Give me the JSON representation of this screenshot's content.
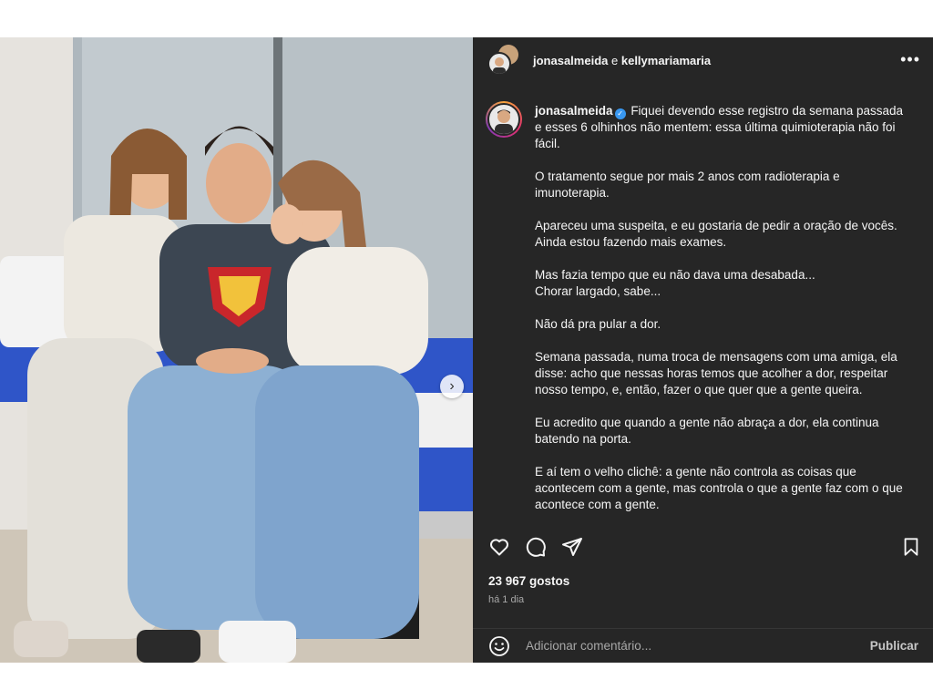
{
  "post": {
    "photo_alt": "Three people seated on a hospital bed hugging",
    "carousel_next_icon": "chevron-right-icon",
    "tag_icon": "user-icon"
  },
  "header": {
    "user1": "jonasalmeida",
    "conjunction": "e",
    "user2": "kellymariamaria",
    "more_icon": "more-horizontal-icon"
  },
  "caption": {
    "username": "jonasalmeida",
    "verified_icon": "verified-badge-icon",
    "paragraphs": [
      "Fiquei devendo esse registro da semana passada e esses 6 olhinhos não mentem: essa última quimioterapia não foi fácil.",
      "O tratamento segue por mais 2 anos com radioterapia e imunoterapia.",
      "Apareceu uma suspeita, e eu gostaria de pedir a oração de vocês. Ainda estou fazendo mais exames.",
      "Mas fazia tempo que eu não dava uma desabada...\nChorar largado, sabe...",
      "Não dá pra pular a dor.",
      "Semana passada, numa troca de mensagens com uma amiga, ela disse: acho que nessas horas temos que acolher a dor, respeitar nosso tempo, e, então, fazer o que quer que a gente queira.",
      "Eu acredito que quando a gente não abraça a dor, ela continua batendo na porta.",
      "E aí tem o velho clichê: a gente não controla as coisas que acontecem com a gente, mas controla o que a gente faz com o que acontece com a gente."
    ]
  },
  "actions": {
    "like_icon": "heart-icon",
    "comment_icon": "comment-icon",
    "share_icon": "send-icon",
    "save_icon": "bookmark-icon"
  },
  "stats": {
    "likes": "23 967 gostos",
    "time": "há 1 dia"
  },
  "comment": {
    "emoji_icon": "emoji-icon",
    "placeholder": "Adicionar comentário...",
    "publish_label": "Publicar"
  }
}
